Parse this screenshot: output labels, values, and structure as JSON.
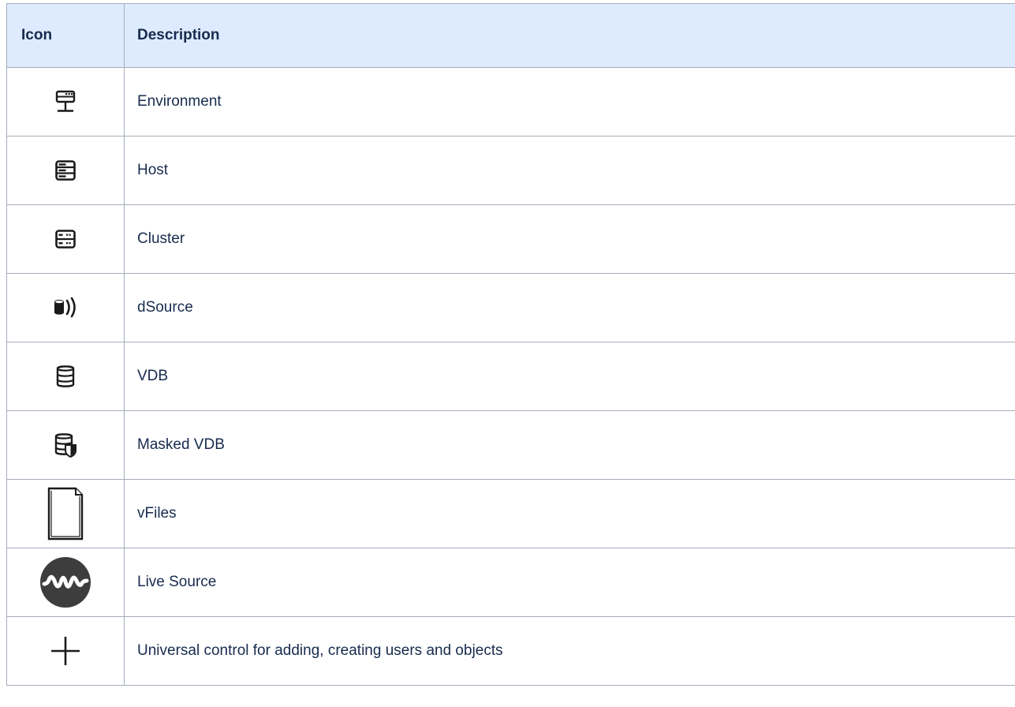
{
  "table": {
    "headers": {
      "icon": "Icon",
      "description": "Description"
    },
    "rows": [
      {
        "icon": "environment-icon",
        "description": "Environment"
      },
      {
        "icon": "host-icon",
        "description": "Host"
      },
      {
        "icon": "cluster-icon",
        "description": "Cluster"
      },
      {
        "icon": "dsource-icon",
        "description": "dSource"
      },
      {
        "icon": "vdb-icon",
        "description": "VDB"
      },
      {
        "icon": "masked-vdb-icon",
        "description": "Masked VDB"
      },
      {
        "icon": "vfiles-icon",
        "description": "vFiles"
      },
      {
        "icon": "live-source-icon",
        "description": "Live Source"
      },
      {
        "icon": "plus-icon",
        "description": "Universal control for adding, creating users and objects"
      }
    ]
  },
  "colors": {
    "header_background": "#deebff",
    "border": "#a5adba",
    "text": "#172b4d",
    "icon": "#1a1a1a",
    "live_source_badge": "#3d3d3d"
  }
}
